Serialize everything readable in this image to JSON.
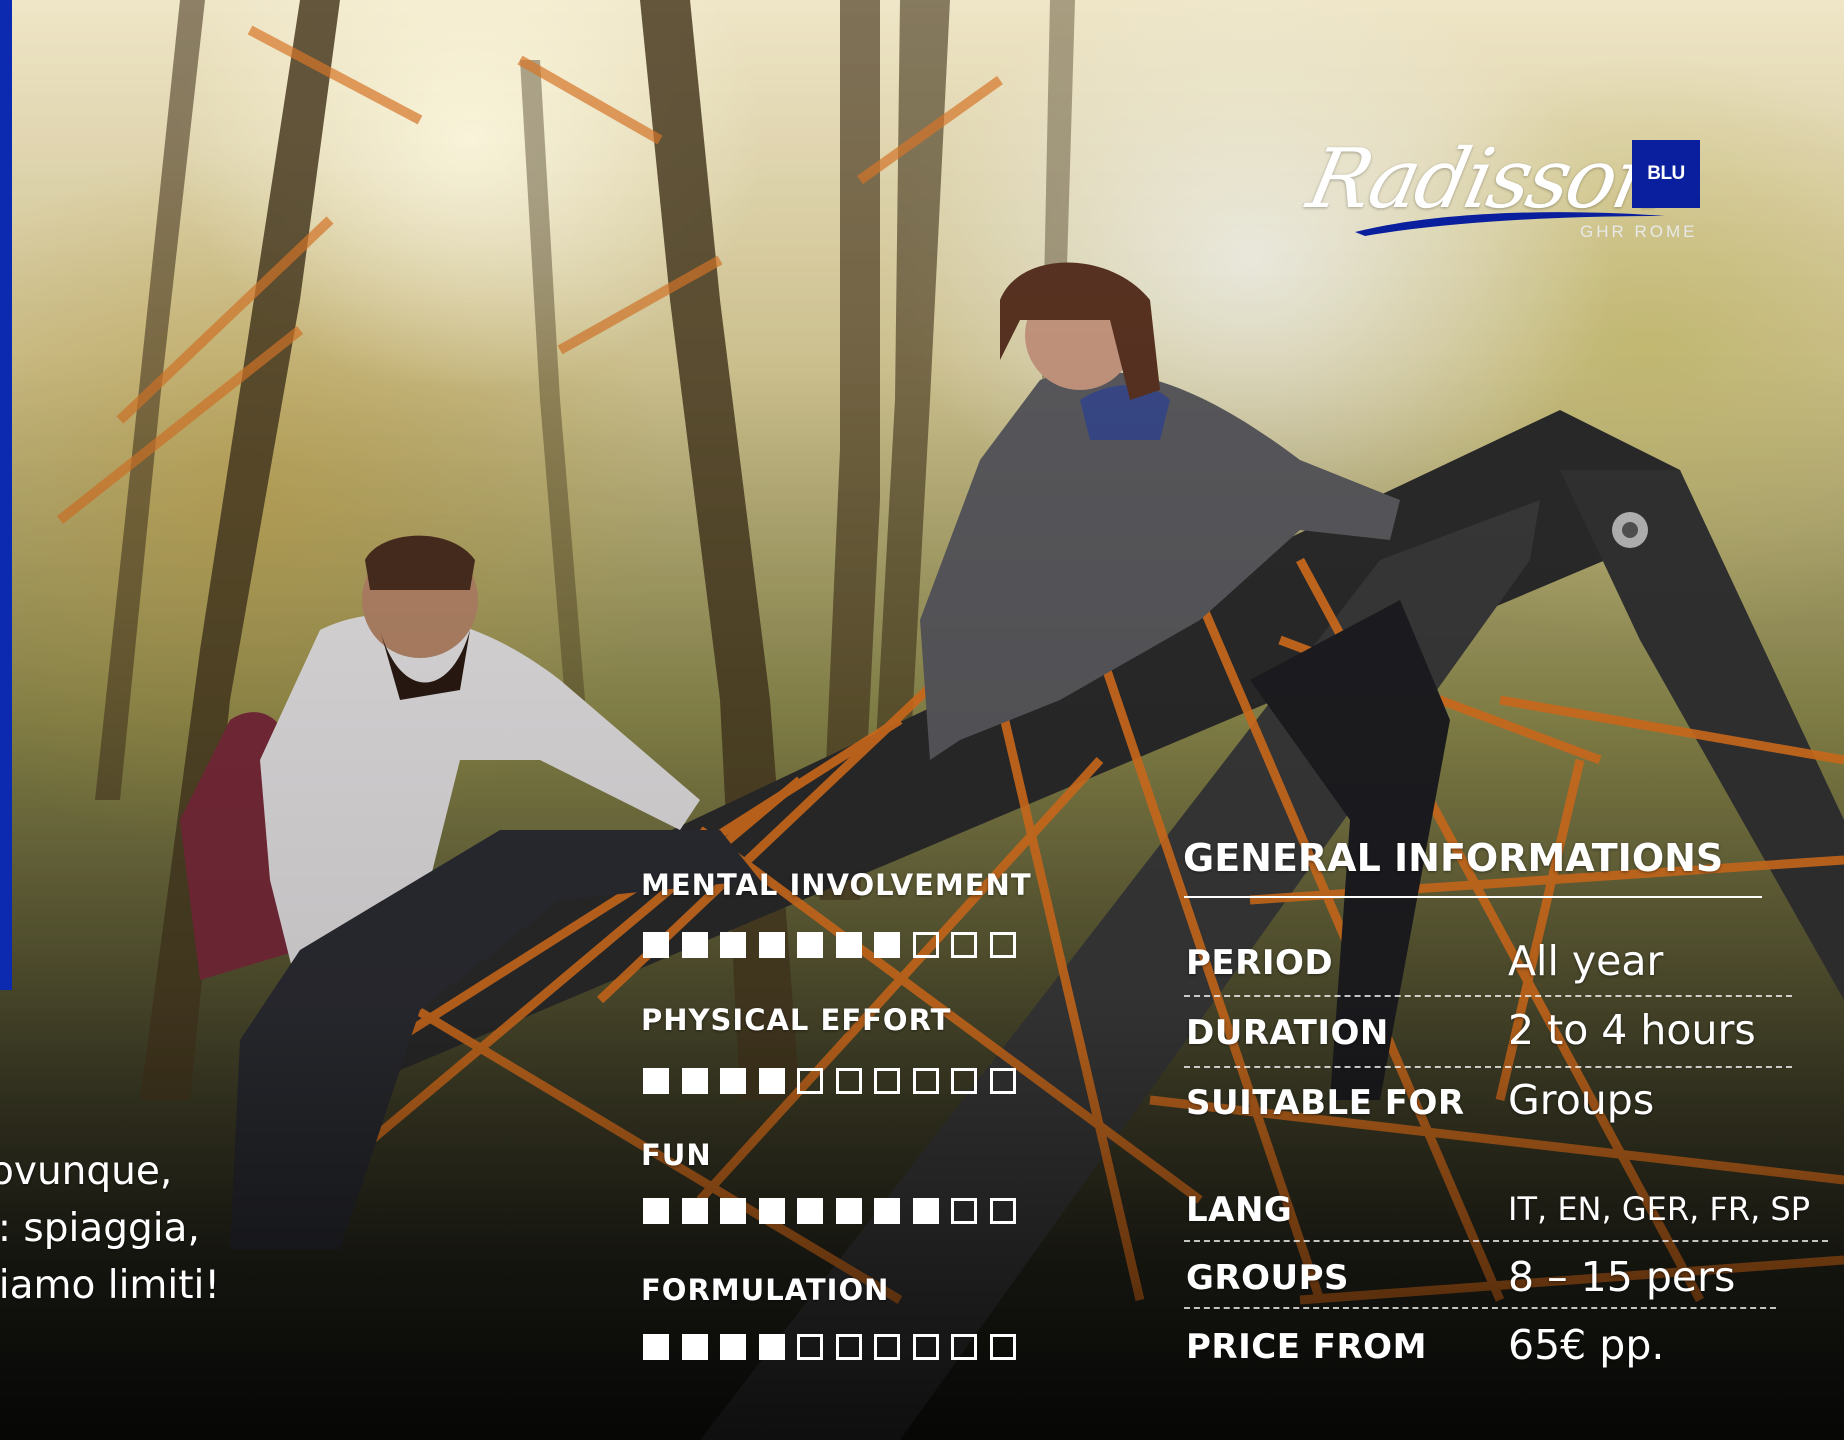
{
  "brochure": {
    "italian_text_lines": [
      "ovunque,",
      "o: spiaggia,",
      "biamo limiti!"
    ]
  },
  "logo": {
    "script_text": "Radisson",
    "box_text": "BLU",
    "sub_text": "GHR ROME",
    "brand_blue": "#0a1f9e"
  },
  "ratings": [
    {
      "label": "MENTAL INVOLVEMENT",
      "filled": 7,
      "total": 10
    },
    {
      "label": "PHYSICAL  EFFORT",
      "filled": 4,
      "total": 10
    },
    {
      "label": "FUN",
      "filled": 8,
      "total": 10
    },
    {
      "label": "FORMULATION",
      "filled": 4,
      "total": 10
    }
  ],
  "general_info": {
    "title": "GENERAL INFORMATIONS",
    "rows": [
      {
        "label": "PERIOD",
        "value": "All year"
      },
      {
        "label": "DURATION",
        "value": "2 to 4 hours"
      },
      {
        "label": "SUITABLE FOR",
        "value": "Groups"
      },
      {
        "label": "LANG",
        "value": "IT, EN, GER,  FR, SP"
      },
      {
        "label": "GROUPS",
        "value": "8 – 15 pers"
      },
      {
        "label": "PRICE FROM",
        "value": "65€ pp."
      }
    ]
  },
  "colors": {
    "accent_blue": "#0b2ab0",
    "net_orange": "#e0741e"
  }
}
